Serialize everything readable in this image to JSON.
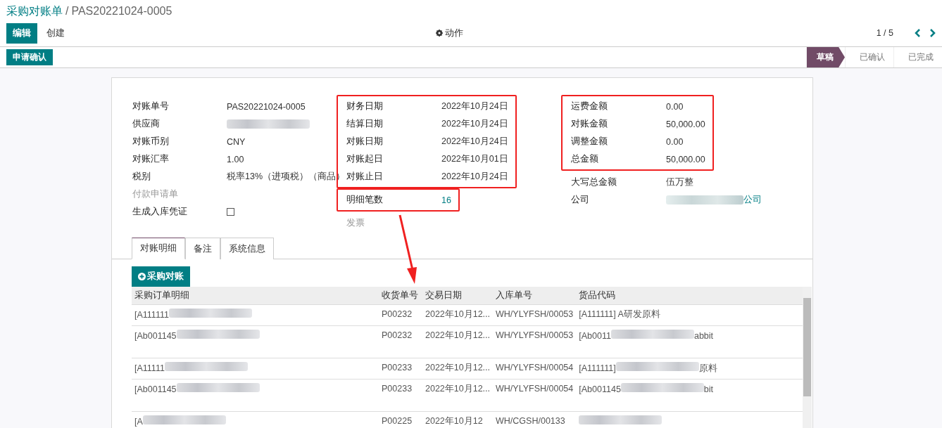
{
  "breadcrumb": {
    "parent": "采购对账单",
    "separator": "/",
    "current": "PAS20221024-0005"
  },
  "toolbar": {
    "buttons": [
      {
        "label": "编辑",
        "primary": true
      },
      {
        "label": "创建",
        "primary": false
      }
    ],
    "action": "动作",
    "pager": "1 / 5"
  },
  "status_bar": {
    "button": "申请确认",
    "stages": [
      {
        "label": "草稿",
        "selected": true
      },
      {
        "label": "已确认",
        "selected": false
      },
      {
        "label": "已完成",
        "selected": false
      }
    ]
  },
  "columns": [
    [
      {
        "highlighted": false,
        "fields": [
          {
            "label": "对账单号",
            "muted": false,
            "kind": "text",
            "value": [
              {
                "kind": "text",
                "text": "PAS20221024-0005"
              }
            ]
          },
          {
            "label": "供应商",
            "muted": false,
            "kind": "text",
            "value": [
              {
                "kind": "redacted"
              }
            ]
          },
          {
            "label": "对账币别",
            "muted": false,
            "kind": "text",
            "value": [
              {
                "kind": "text",
                "text": "CNY"
              }
            ]
          },
          {
            "label": "对账汇率",
            "muted": false,
            "kind": "text",
            "value": [
              {
                "kind": "text",
                "text": "1.00"
              }
            ]
          },
          {
            "label": "税别",
            "muted": false,
            "kind": "text",
            "value": [
              {
                "kind": "text",
                "text": "税率13%（进项税）（商品）"
              }
            ]
          },
          {
            "label": "付款申请单",
            "muted": true,
            "kind": "text"
          },
          {
            "label": "生成入库凭证",
            "muted": false,
            "kind": "checkbox",
            "checked": false
          }
        ]
      }
    ],
    [
      {
        "highlighted": true,
        "fields": [
          {
            "label": "财务日期",
            "muted": false,
            "kind": "text",
            "value": [
              {
                "kind": "text",
                "text": "2022年10月24日"
              }
            ]
          },
          {
            "label": "结算日期",
            "muted": false,
            "kind": "text",
            "value": [
              {
                "kind": "text",
                "text": "2022年10月24日"
              }
            ]
          },
          {
            "label": "对账日期",
            "muted": false,
            "kind": "text",
            "value": [
              {
                "kind": "text",
                "text": "2022年10月24日"
              }
            ]
          },
          {
            "label": "对账起日",
            "muted": false,
            "kind": "text",
            "value": [
              {
                "kind": "text",
                "text": "2022年10月01日"
              }
            ]
          },
          {
            "label": "对账止日",
            "muted": false,
            "kind": "text",
            "value": [
              {
                "kind": "text",
                "text": "2022年10月24日"
              }
            ]
          }
        ]
      },
      {
        "highlighted": true,
        "fields": [
          {
            "label": "明细笔数",
            "muted": false,
            "kind": "link",
            "value": [
              {
                "kind": "text",
                "text": "16"
              }
            ]
          }
        ]
      },
      {
        "highlighted": false,
        "fields": [
          {
            "label": "发票",
            "muted": true,
            "kind": "text"
          }
        ]
      }
    ],
    [
      {
        "highlighted": true,
        "fields": [
          {
            "label": "运费金额",
            "muted": false,
            "kind": "text",
            "value": [
              {
                "kind": "text",
                "text": "0.00"
              }
            ]
          },
          {
            "label": "对账金额",
            "muted": false,
            "kind": "text",
            "value": [
              {
                "kind": "text",
                "text": "50,000.00"
              }
            ]
          },
          {
            "label": "调整金额",
            "muted": false,
            "kind": "text",
            "value": [
              {
                "kind": "text",
                "text": "0.00"
              }
            ]
          },
          {
            "label": "总金额",
            "muted": false,
            "kind": "text",
            "value": [
              {
                "kind": "text",
                "text": "50,000.00"
              }
            ]
          }
        ]
      },
      {
        "highlighted": false,
        "fields": [
          {
            "label": "大写总金额",
            "muted": false,
            "kind": "text",
            "value": [
              {
                "kind": "text",
                "text": "伍万整"
              }
            ]
          },
          {
            "label": "公司",
            "muted": false,
            "kind": "link",
            "value": [
              {
                "kind": "redacted"
              },
              {
                "kind": "text",
                "text": "公司"
              }
            ]
          }
        ]
      }
    ]
  ],
  "tabs": [
    {
      "label": "对账明细",
      "selected": true
    },
    {
      "label": "备注",
      "selected": false
    },
    {
      "label": "系统信息",
      "selected": false
    }
  ],
  "add_button": "采购对账",
  "table": {
    "columns": [
      "采购订单明细",
      "收货单号",
      "交易日期",
      "入库单号",
      "货品代码"
    ],
    "rows": [
      {
        "tall": false,
        "cells": [
          [
            {
              "kind": "text",
              "text": "[A111111"
            },
            {
              "kind": "redacted"
            }
          ],
          [
            {
              "kind": "text",
              "text": "P00232"
            }
          ],
          [
            {
              "kind": "text",
              "text": "2022年10月12..."
            }
          ],
          [
            {
              "kind": "text",
              "text": "WH/YLYFSH/00053"
            }
          ],
          [
            {
              "kind": "text",
              "text": "[A111111] A研发原料"
            }
          ]
        ]
      },
      {
        "tall": true,
        "cells": [
          [
            {
              "kind": "text",
              "text": "[Ab001145"
            },
            {
              "kind": "redacted"
            }
          ],
          [
            {
              "kind": "text",
              "text": "P00232"
            }
          ],
          [
            {
              "kind": "text",
              "text": "2022年10月12..."
            }
          ],
          [
            {
              "kind": "text",
              "text": "WH/YLYFSH/00053"
            }
          ],
          [
            {
              "kind": "text",
              "text": "[Ab0011"
            },
            {
              "kind": "redacted"
            },
            {
              "kind": "text",
              "text": "abbit"
            }
          ]
        ]
      },
      {
        "tall": false,
        "cells": [
          [
            {
              "kind": "text",
              "text": "[A11111"
            },
            {
              "kind": "redacted"
            }
          ],
          [
            {
              "kind": "text",
              "text": "P00233"
            }
          ],
          [
            {
              "kind": "text",
              "text": "2022年10月12..."
            }
          ],
          [
            {
              "kind": "text",
              "text": "WH/YLYFSH/00054"
            }
          ],
          [
            {
              "kind": "text",
              "text": "[A111111]"
            },
            {
              "kind": "redacted"
            },
            {
              "kind": "text",
              "text": "原料"
            }
          ]
        ]
      },
      {
        "tall": true,
        "cells": [
          [
            {
              "kind": "text",
              "text": "[Ab001145"
            },
            {
              "kind": "redacted"
            }
          ],
          [
            {
              "kind": "text",
              "text": "P00233"
            }
          ],
          [
            {
              "kind": "text",
              "text": "2022年10月12..."
            }
          ],
          [
            {
              "kind": "text",
              "text": "WH/YLYFSH/00054"
            }
          ],
          [
            {
              "kind": "text",
              "text": "[Ab001145"
            },
            {
              "kind": "redacted"
            },
            {
              "kind": "text",
              "text": "bit"
            }
          ]
        ]
      },
      {
        "cells": [
          [
            {
              "kind": "text",
              "text": "[A"
            },
            {
              "kind": "redacted"
            }
          ],
          [
            {
              "kind": "text",
              "text": "P00225"
            }
          ],
          [
            {
              "kind": "text",
              "text": "2022年10月12"
            }
          ],
          [
            {
              "kind": "text",
              "text": "WH/CGSH/00133"
            }
          ],
          [
            {
              "kind": "redacted"
            }
          ]
        ]
      }
    ]
  }
}
